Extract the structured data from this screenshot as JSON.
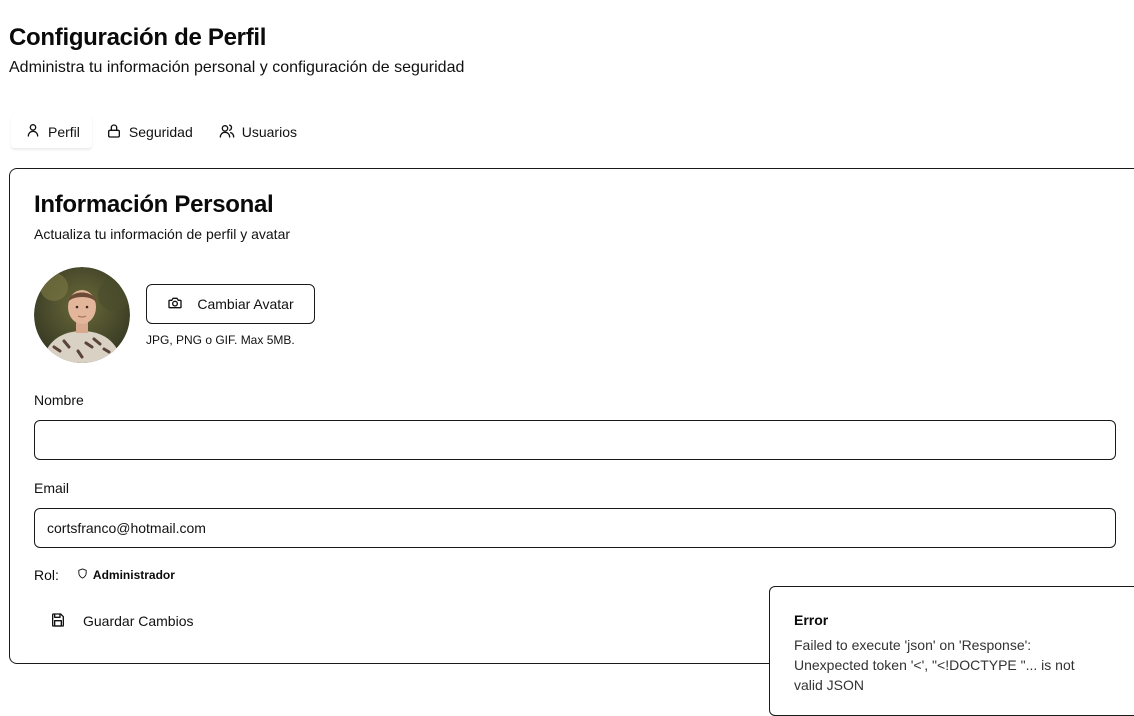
{
  "header": {
    "title": "Configuración de Perfil",
    "subtitle": "Administra tu información personal y configuración de seguridad"
  },
  "tabs": [
    {
      "label": "Perfil",
      "icon": "user-icon",
      "active": true
    },
    {
      "label": "Seguridad",
      "icon": "lock-icon",
      "active": false
    },
    {
      "label": "Usuarios",
      "icon": "users-icon",
      "active": false
    }
  ],
  "card": {
    "title": "Información Personal",
    "description": "Actualiza tu información de perfil y avatar"
  },
  "avatar": {
    "button_label": "Cambiar Avatar",
    "hint": "JPG, PNG o GIF. Max 5MB."
  },
  "form": {
    "name_label": "Nombre",
    "name_value": "",
    "email_label": "Email",
    "email_value": "cortsfranco@hotmail.com",
    "role_label": "Rol:",
    "role_value": "Administrador",
    "save_label": "Guardar Cambios"
  },
  "toast": {
    "title": "Error",
    "message": "Failed to execute 'json' on 'Response': Unexpected token '<', \"<!DOCTYPE \"... is not valid JSON"
  },
  "colors": {
    "border": "#1a1a1a",
    "text": "#0a0a0a",
    "background": "#ffffff"
  }
}
